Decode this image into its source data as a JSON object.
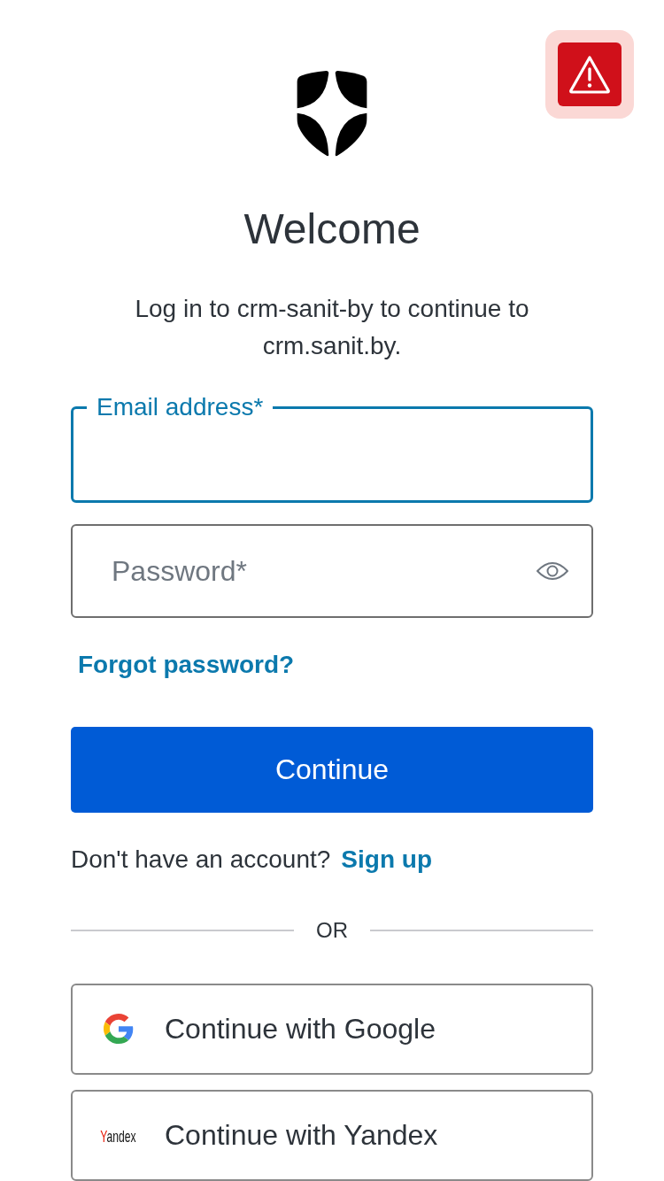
{
  "title": "Welcome",
  "subtitle": "Log in to crm-sanit-by to continue to crm.sanit.by.",
  "fields": [
    {
      "kind": "email",
      "label": "Email address*",
      "focused": true
    },
    {
      "kind": "password",
      "placeholder": "Password*",
      "focused": false
    }
  ],
  "forgot_link": "Forgot password?",
  "continue_button": "Continue",
  "signup_prompt": {
    "text": "Don't have an account?",
    "link": "Sign up"
  },
  "divider": "OR",
  "social_buttons": [
    {
      "kind": "google",
      "label": "Continue with Google"
    },
    {
      "kind": "yandex",
      "logo_text": "Yandex",
      "label": "Continue with Yandex"
    }
  ]
}
